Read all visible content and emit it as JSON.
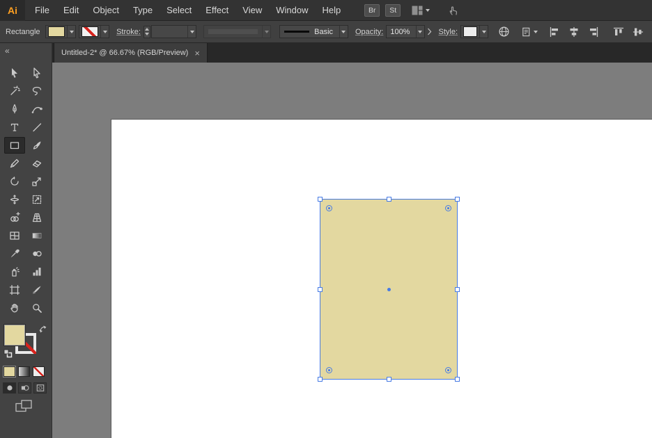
{
  "colors": {
    "accent_blue": "#477be4",
    "shape_fill_tan": "#e3d8a0",
    "logo_orange": "#ffa021",
    "none_red": "#d7231d"
  },
  "menubar": {
    "logo": "Ai",
    "menus": [
      {
        "label": "File"
      },
      {
        "label": "Edit"
      },
      {
        "label": "Object"
      },
      {
        "label": "Type"
      },
      {
        "label": "Select"
      },
      {
        "label": "Effect"
      },
      {
        "label": "View"
      },
      {
        "label": "Window"
      },
      {
        "label": "Help"
      }
    ],
    "buttons": [
      {
        "label": "Br"
      },
      {
        "label": "St"
      }
    ],
    "icons": [
      "workspace-switcher-icon",
      "chevron-down-icon",
      "touch-workspace-icon"
    ]
  },
  "controlbar": {
    "context_label": "Rectangle",
    "stroke_label": "Stroke:",
    "stroke_value": "",
    "brush_value": "Basic",
    "opacity_label": "Opacity:",
    "opacity_value": "100%",
    "style_label": "Style:",
    "icons": [
      "fill-swatch",
      "stroke-none-swatch",
      "recolor-artwork-icon",
      "select-similar-icon"
    ],
    "align_icons": [
      "horizontal-align-left",
      "horizontal-align-center",
      "horizontal-align-right",
      "vertical-align-top",
      "vertical-align-center"
    ]
  },
  "tabbar": {
    "tabs": [
      {
        "title": "Untitled-2* @ 66.67% (RGB/Preview)",
        "close_glyph": "×",
        "active": true
      }
    ]
  },
  "toolbar": {
    "collapse_glyph": "«",
    "tools": [
      {
        "name": "selection",
        "selected": false
      },
      {
        "name": "direct-selection",
        "selected": false
      },
      {
        "name": "magic-wand",
        "selected": false
      },
      {
        "name": "lasso",
        "selected": false
      },
      {
        "name": "pen",
        "selected": false
      },
      {
        "name": "curvature",
        "selected": false
      },
      {
        "name": "type",
        "selected": false
      },
      {
        "name": "line-segment",
        "selected": false
      },
      {
        "name": "rectangle",
        "selected": true
      },
      {
        "name": "paintbrush",
        "selected": false
      },
      {
        "name": "shaper",
        "selected": false
      },
      {
        "name": "eraser",
        "selected": false
      },
      {
        "name": "rotate",
        "selected": false
      },
      {
        "name": "scale",
        "selected": false
      },
      {
        "name": "width",
        "selected": false
      },
      {
        "name": "free-transform",
        "selected": false
      },
      {
        "name": "shape-builder",
        "selected": false
      },
      {
        "name": "perspective-grid",
        "selected": false
      },
      {
        "name": "mesh",
        "selected": false
      },
      {
        "name": "gradient",
        "selected": false
      },
      {
        "name": "eyedropper",
        "selected": false
      },
      {
        "name": "blend",
        "selected": false
      },
      {
        "name": "symbol-sprayer",
        "selected": false
      },
      {
        "name": "column-graph",
        "selected": false
      },
      {
        "name": "artboard",
        "selected": false
      },
      {
        "name": "slice",
        "selected": false
      },
      {
        "name": "hand",
        "selected": false
      },
      {
        "name": "zoom",
        "selected": false
      }
    ],
    "swatch_buttons": [
      {
        "name": "color"
      },
      {
        "name": "gradient"
      },
      {
        "name": "none"
      }
    ],
    "draw_modes": [
      {
        "name": "draw-normal",
        "active": true
      },
      {
        "name": "draw-behind",
        "active": false
      },
      {
        "name": "draw-inside",
        "active": false
      }
    ]
  },
  "canvas": {
    "selected_object": {
      "type": "rectangle",
      "fill": "#e3d8a0"
    }
  }
}
